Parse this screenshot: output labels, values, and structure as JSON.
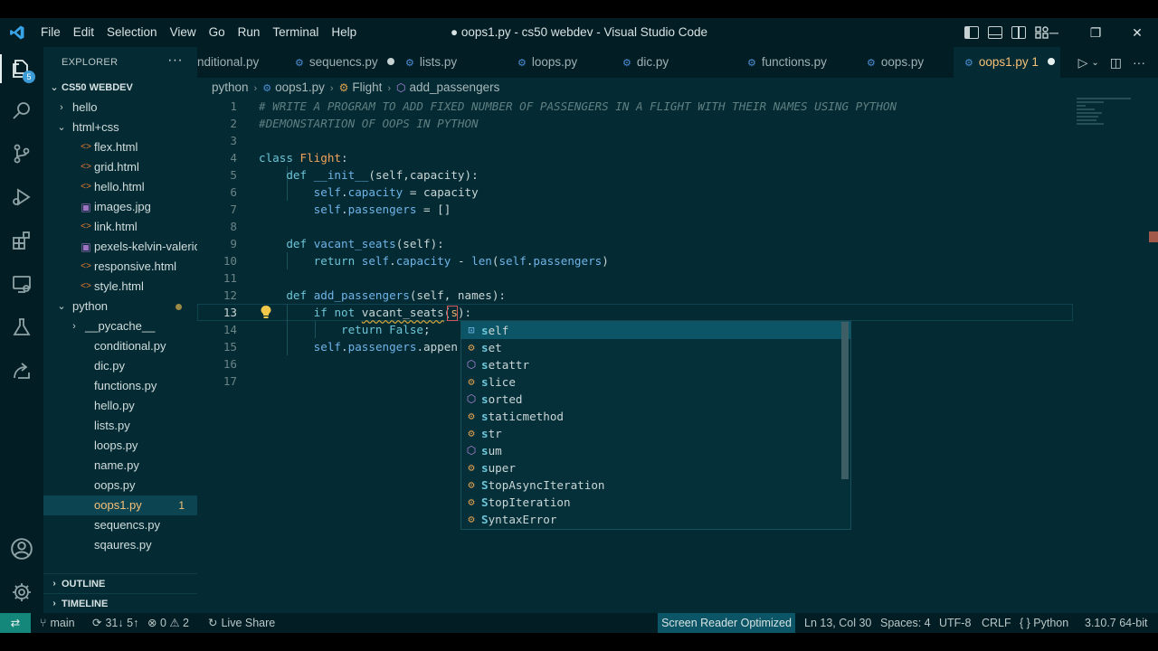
{
  "window": {
    "title": "● oops1.py - cs50 webdev - Visual Studio Code"
  },
  "menu": [
    "File",
    "Edit",
    "Selection",
    "View",
    "Go",
    "Run",
    "Terminal",
    "Help"
  ],
  "window_controls": {
    "minimize": "─",
    "restore": "❐",
    "close": "✕"
  },
  "activity": {
    "explorer_badge": "5"
  },
  "sidebar": {
    "title": "EXPLORER",
    "more": "···",
    "root": "CS50 WEBDEV",
    "items": [
      {
        "label": "hello",
        "type": "folder",
        "twisty": "›"
      },
      {
        "label": "html+css",
        "type": "folder",
        "twisty": "⌄"
      },
      {
        "label": "flex.html",
        "type": "html",
        "icon": "<>"
      },
      {
        "label": "grid.html",
        "type": "html",
        "icon": "<>"
      },
      {
        "label": "hello.html",
        "type": "html",
        "icon": "<>"
      },
      {
        "label": "images.jpg",
        "type": "image",
        "icon": "▣"
      },
      {
        "label": "link.html",
        "type": "html",
        "icon": "<>"
      },
      {
        "label": "pexels-kelvin-valerio...",
        "type": "image",
        "icon": "▣"
      },
      {
        "label": "responsive.html",
        "type": "html",
        "icon": "<>"
      },
      {
        "label": "style.html",
        "type": "html",
        "icon": "<>"
      },
      {
        "label": "python",
        "type": "folder",
        "twisty": "⌄"
      },
      {
        "label": "__pycache__",
        "type": "folder",
        "twisty": "›"
      },
      {
        "label": "conditional.py",
        "type": "py"
      },
      {
        "label": "dic.py",
        "type": "py"
      },
      {
        "label": "functions.py",
        "type": "py"
      },
      {
        "label": "hello.py",
        "type": "py"
      },
      {
        "label": "lists.py",
        "type": "py"
      },
      {
        "label": "loops.py",
        "type": "py"
      },
      {
        "label": "name.py",
        "type": "py"
      },
      {
        "label": "oops.py",
        "type": "py"
      },
      {
        "label": "oops1.py",
        "type": "py",
        "problems": "1"
      },
      {
        "label": "sequencs.py",
        "type": "py"
      },
      {
        "label": "sqaures.py",
        "type": "py"
      }
    ],
    "outline": "OUTLINE",
    "timeline": "TIMELINE"
  },
  "tabs": [
    {
      "label": "nditional.py"
    },
    {
      "label": "sequencs.py",
      "dirty": true
    },
    {
      "label": "lists.py"
    },
    {
      "label": "loops.py"
    },
    {
      "label": "dic.py"
    },
    {
      "label": "functions.py"
    },
    {
      "label": "oops.py"
    },
    {
      "label": "oops1.py 1",
      "dirty": true,
      "active": true
    }
  ],
  "breadcrumb": [
    "python",
    "oops1.py",
    "Flight",
    "add_passengers"
  ],
  "editor": {
    "line_numbers": [
      "1",
      "2",
      "3",
      "4",
      "5",
      "6",
      "7",
      "8",
      "9",
      "10",
      "11",
      "12",
      "13",
      "14",
      "15",
      "16",
      "17"
    ],
    "comment1": "# WRITE A PROGRAM TO ADD FIXED NUMBER OF PASSENGERS IN A FLIGHT WITH THEIR NAMES USING PYTHON",
    "comment2": "#DEMONSTARTION OF OOPS IN PYTHON"
  },
  "suggestions": [
    {
      "label": "self",
      "kind": "variable",
      "selected": true
    },
    {
      "label": "set",
      "kind": "class"
    },
    {
      "label": "setattr",
      "kind": "function"
    },
    {
      "label": "slice",
      "kind": "class"
    },
    {
      "label": "sorted",
      "kind": "function"
    },
    {
      "label": "staticmethod",
      "kind": "class"
    },
    {
      "label": "str",
      "kind": "class"
    },
    {
      "label": "sum",
      "kind": "function"
    },
    {
      "label": "super",
      "kind": "class"
    },
    {
      "label": "StopAsyncIteration",
      "kind": "class"
    },
    {
      "label": "StopIteration",
      "kind": "class"
    },
    {
      "label": "SyntaxError",
      "kind": "class"
    }
  ],
  "statusbar": {
    "remote": "⇄",
    "branch": "main",
    "sync": "31↓ 5↑",
    "problems": "⊗ 0 ⚠ 2",
    "liveshare": "Live Share",
    "screen_reader": "Screen Reader Optimized",
    "position": "Ln 13, Col 30",
    "spaces": "Spaces: 4",
    "encoding": "UTF-8",
    "eol": "CRLF",
    "language": "{ } Python",
    "interpreter": "3.10.7 64-bit"
  },
  "colors": {
    "background": "#042a33",
    "titlebar": "#031d24",
    "accent": "#14867a",
    "modified": "#f6c177"
  }
}
